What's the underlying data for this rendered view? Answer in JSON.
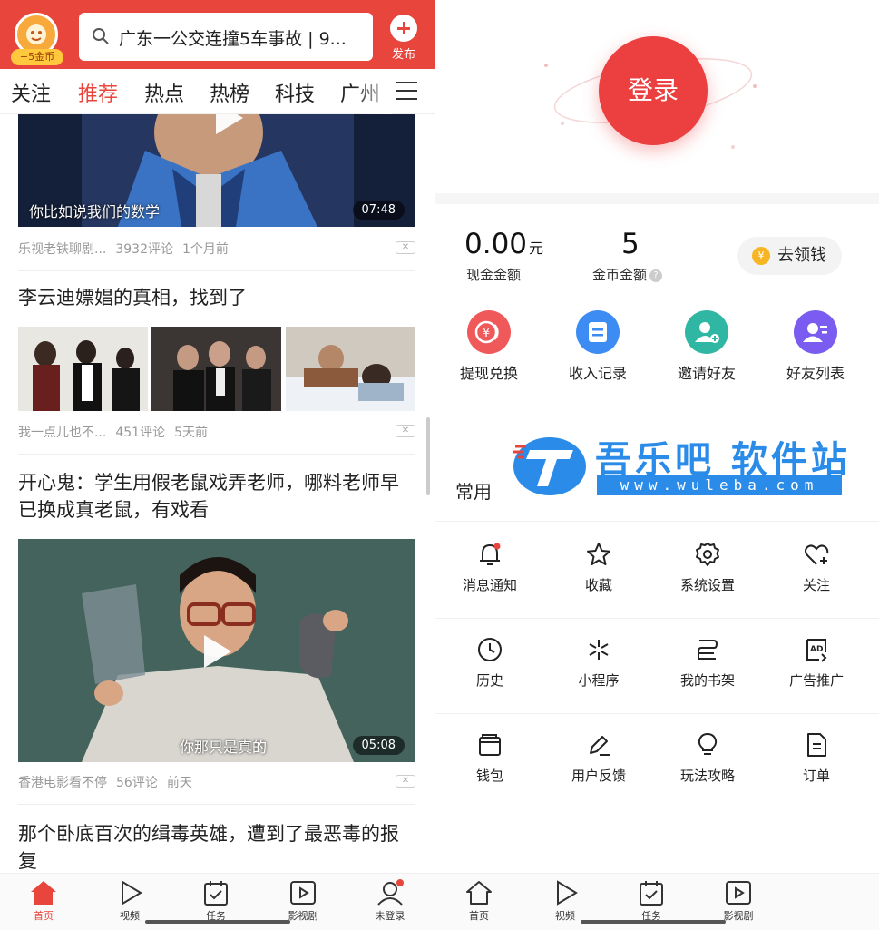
{
  "left": {
    "coin_badge": "+5金币",
    "search_text": "广东一公交连撞5车事故 | 9...",
    "publish_label": "发布",
    "tabs": [
      "关注",
      "推荐",
      "热点",
      "热榜",
      "科技",
      "广州"
    ],
    "active_tab": "推荐",
    "feed": [
      {
        "subtitle": "你比如说我们的数学",
        "duration": "07:48",
        "source": "乐视老铁聊剧...",
        "comments": "3932评论",
        "time": "1个月前"
      },
      {
        "title": "李云迪嫖娼的真相，找到了",
        "source": "我一点儿也不...",
        "comments": "451评论",
        "time": "5天前"
      },
      {
        "title": "开心鬼：学生用假老鼠戏弄老师，哪料老师早已换成真老鼠，有戏看",
        "subtitle": "你那只是真的",
        "duration": "05:08",
        "source": "香港电影看不停",
        "comments": "56评论",
        "time": "前天"
      },
      {
        "title": "那个卧底百次的缉毒英雄，遭到了最恶毒的报复"
      }
    ],
    "close_label": "✕",
    "nav": [
      "首页",
      "视频",
      "任务",
      "影视剧",
      "未登录"
    ]
  },
  "right": {
    "login_label": "登录",
    "cash_value": "0.00",
    "cash_unit": "元",
    "cash_label": "现金金额",
    "coin_value": "5",
    "coin_label": "金币金额",
    "coin_help": "?",
    "get_money_label": "去领钱",
    "get_money_icon": "¥",
    "quick": [
      {
        "label": "提现兑换",
        "icon": "exchange-icon",
        "color": "#f0595a"
      },
      {
        "label": "收入记录",
        "icon": "record-icon",
        "color": "#3d8cf3"
      },
      {
        "label": "邀请好友",
        "icon": "invite-icon",
        "color": "#2fb7a3"
      },
      {
        "label": "好友列表",
        "icon": "friends-icon",
        "color": "#7a5cf0"
      }
    ],
    "common_title": "常用",
    "watermark_title": "吾乐吧 软件站",
    "watermark_url": "www.wuleba.com",
    "grid": [
      "消息通知",
      "收藏",
      "系统设置",
      "关注",
      "历史",
      "小程序",
      "我的书架",
      "广告推广",
      "钱包",
      "用户反馈",
      "玩法攻略",
      "订单"
    ],
    "nav": [
      "首页",
      "视频",
      "任务",
      "影视剧"
    ]
  },
  "colors": {
    "brand_red": "#e8453c",
    "login_red": "#ec3f3f",
    "watermark_blue": "#2a8be8"
  }
}
